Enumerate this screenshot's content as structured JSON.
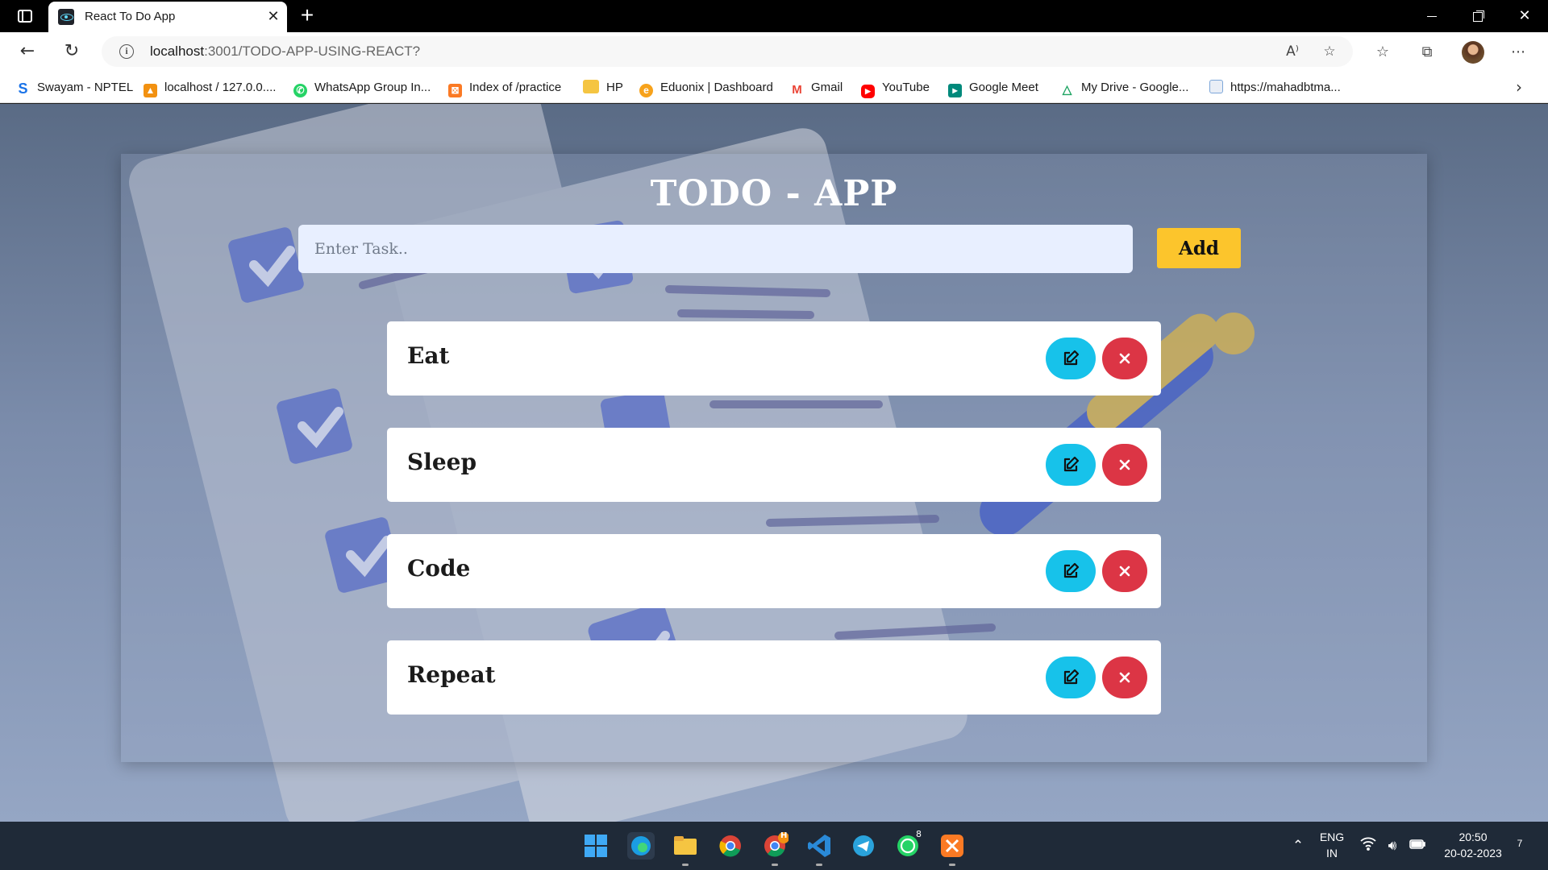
{
  "browser": {
    "tab_title": "React To Do App",
    "url_host": "localhost",
    "url_rest": ":3001/TODO-APP-USING-REACT?",
    "bookmarks": [
      {
        "label": "Swayam - NPTEL",
        "icon": "swayam-icon",
        "color": "#1a73e8"
      },
      {
        "label": "localhost / 127.0.0....",
        "icon": "phpmyadmin-icon",
        "color": "#f29111"
      },
      {
        "label": "WhatsApp Group In...",
        "icon": "whatsapp-icon",
        "color": "#25d366"
      },
      {
        "label": "Index of /practice",
        "icon": "xampp-icon",
        "color": "#fb7a24"
      },
      {
        "label": "HP",
        "icon": "folder-icon",
        "color": "#f5c542"
      },
      {
        "label": "Eduonix | Dashboard",
        "icon": "eduonix-icon",
        "color": "#f7a21b"
      },
      {
        "label": "Gmail",
        "icon": "gmail-icon",
        "color": "#ea4335"
      },
      {
        "label": "YouTube",
        "icon": "youtube-icon",
        "color": "#ff0000"
      },
      {
        "label": "Google Meet",
        "icon": "google-meet-icon",
        "color": "#00897b"
      },
      {
        "label": "My Drive - Google...",
        "icon": "google-drive-icon",
        "color": "#1fa463"
      },
      {
        "label": "https://mahadbtma...",
        "icon": "page-icon",
        "color": "#7da7d9"
      }
    ]
  },
  "app": {
    "title": "TODO - APP",
    "input_placeholder": "Enter Task..",
    "input_value": "",
    "add_label": "Add",
    "todos": [
      {
        "text": "Eat"
      },
      {
        "text": "Sleep"
      },
      {
        "text": "Code"
      },
      {
        "text": "Repeat"
      }
    ],
    "colors": {
      "add": "#fcc52c",
      "edit": "#17c2ea",
      "delete": "#dc3545"
    }
  },
  "taskbar": {
    "lang_line1": "ENG",
    "lang_line2": "IN",
    "time": "20:50",
    "date": "20-02-2023",
    "notification_count": "7",
    "whatsapp_badge": "8",
    "chrome_badge": "H"
  }
}
